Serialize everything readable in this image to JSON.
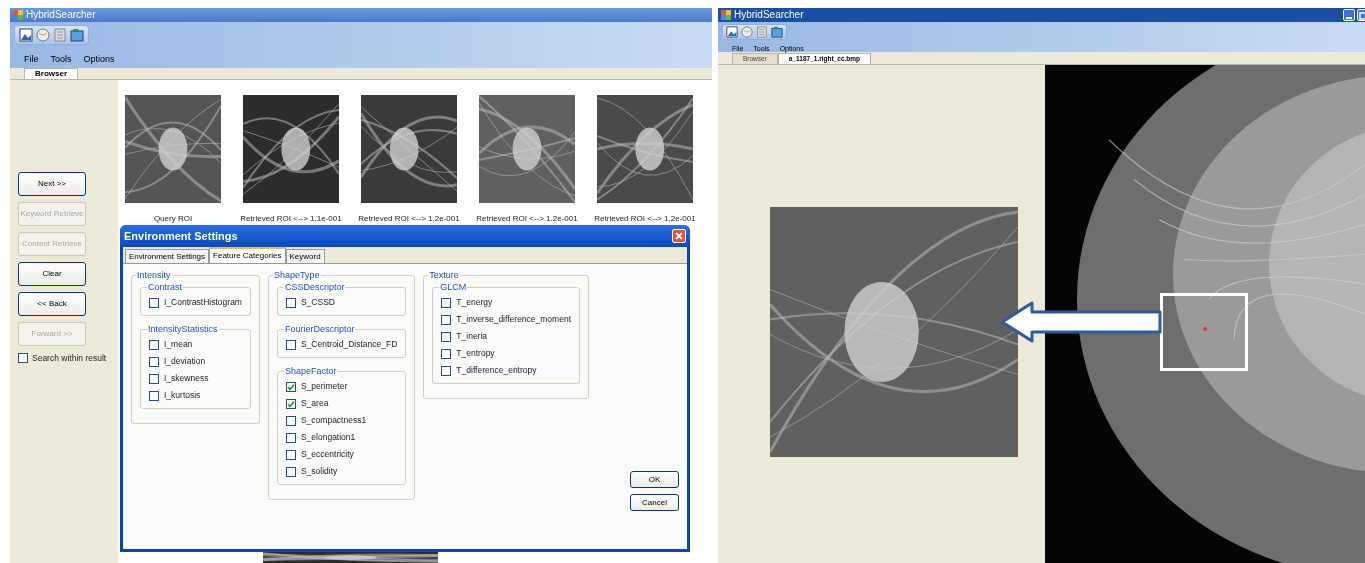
{
  "left_window": {
    "title": "HybridSearcher",
    "menu": [
      "File",
      "Tools",
      "Options"
    ],
    "tabs": [
      {
        "label": "Browser",
        "selected": true
      }
    ],
    "buttons": [
      {
        "label": "Next >>",
        "disabled": false
      },
      {
        "label": "Keyword Retrieve",
        "disabled": true
      },
      {
        "label": "Content Retrieve",
        "disabled": true
      },
      {
        "label": "Clear",
        "disabled": false
      },
      {
        "label": "<< Back",
        "disabled": false
      },
      {
        "label": "Forward >>",
        "disabled": true
      }
    ],
    "search_within_result": {
      "label": "Search within result",
      "checked": false
    },
    "results": [
      {
        "caption": "Query ROI",
        "kind": "picture"
      },
      {
        "caption": "Retrieved ROI <--> 1.1e-001",
        "kind": "picture"
      },
      {
        "caption": "Retrieved ROI <--> 1.2e-001",
        "kind": "picture"
      },
      {
        "caption": "Retrieved ROI <--> 1.2e-001",
        "kind": "picture"
      },
      {
        "caption": "Retrieved ROI <--> 1.2e-001",
        "kind": "picture"
      }
    ]
  },
  "dialog": {
    "title": "Environment Settings",
    "tabs": [
      {
        "label": "Environment Settings",
        "selected": false
      },
      {
        "label": "Feature Categories",
        "selected": true
      },
      {
        "label": "Keyword",
        "selected": false
      }
    ],
    "groups": [
      {
        "title": "Intensity",
        "subgroups": [
          {
            "title": "Contrast",
            "options": [
              {
                "label": "I_ContrastHistogram",
                "checked": false
              }
            ]
          },
          {
            "title": "IntensityStatistics",
            "options": [
              {
                "label": "I_mean",
                "checked": false
              },
              {
                "label": "I_deviation",
                "checked": false
              },
              {
                "label": "I_skewness",
                "checked": false
              },
              {
                "label": "I_kurtosis",
                "checked": false
              }
            ]
          }
        ]
      },
      {
        "title": "ShapeType",
        "subgroups": [
          {
            "title": "CSSDescriptor",
            "options": [
              {
                "label": "S_CSSD",
                "checked": false
              }
            ]
          },
          {
            "title": "FourierDescriptor",
            "options": [
              {
                "label": "S_Centroid_Distance_FD",
                "checked": false
              }
            ]
          },
          {
            "title": "ShapeFactor",
            "options": [
              {
                "label": "S_perimeter",
                "checked": true
              },
              {
                "label": "S_area",
                "checked": true
              },
              {
                "label": "S_compactness1",
                "checked": false
              },
              {
                "label": "S_elongation1",
                "checked": false
              },
              {
                "label": "S_eccentricity",
                "checked": false
              },
              {
                "label": "S_solidity",
                "checked": false
              }
            ]
          }
        ]
      },
      {
        "title": "Texture",
        "subgroups": [
          {
            "title": "GLCM",
            "options": [
              {
                "label": "T_energy",
                "checked": false
              },
              {
                "label": "T_inverse_difference_moment",
                "checked": false
              },
              {
                "label": "T_ineria",
                "checked": false
              },
              {
                "label": "T_entropy",
                "checked": false
              },
              {
                "label": "T_difference_entropy",
                "checked": false
              }
            ]
          }
        ]
      }
    ],
    "buttons": [
      "OK",
      "Cancel"
    ]
  },
  "right_window": {
    "title": "HybridSearcher",
    "menu": [
      "File",
      "Tools",
      "Options"
    ],
    "tabs": [
      {
        "label": "Browser",
        "selected": false
      },
      {
        "label": "a_1187_1.right_cc.bmp",
        "selected": true
      }
    ],
    "views": [
      {
        "kind": "picture"
      },
      {
        "kind": "picture"
      }
    ]
  }
}
